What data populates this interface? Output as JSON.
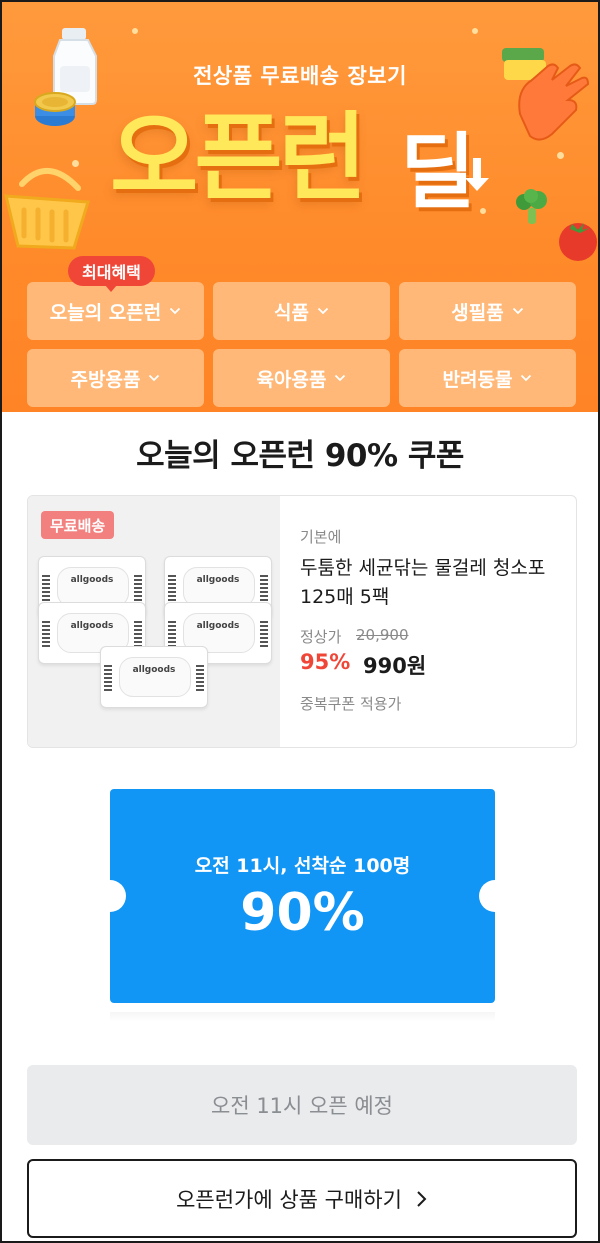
{
  "hero": {
    "subtitle": "전상품 무료배송 장보기",
    "title_main": "오픈런",
    "title_deal": "딜",
    "best_badge": "최대혜택"
  },
  "categories": [
    {
      "label": "오늘의 오픈런",
      "icon": "chevron-down-icon"
    },
    {
      "label": "식품",
      "icon": "chevron-down-icon"
    },
    {
      "label": "생필품",
      "icon": "chevron-down-icon"
    },
    {
      "label": "주방용품",
      "icon": "chevron-down-icon"
    },
    {
      "label": "육아용품",
      "icon": "chevron-down-icon"
    },
    {
      "label": "반려동물",
      "icon": "chevron-down-icon"
    }
  ],
  "section": {
    "title": "오늘의 오픈런 90% 쿠폰"
  },
  "product": {
    "free_shipping_badge": "무료배송",
    "pack_brand": "allgoods",
    "brand": "기본에",
    "name": "두툼한 세균닦는 물걸레 청소포 125매 5팩",
    "original_label": "정상가",
    "original_price": "20,900",
    "discount_rate": "95%",
    "sale_price": "990원",
    "note": "중복쿠폰 적용가"
  },
  "coupon": {
    "subtitle": "오전 11시, 선착순 100명",
    "rate": "90%"
  },
  "buttons": {
    "open_scheduled": "오전 11시 오픈 예정",
    "buy": "오픈런가에 상품 구매하기",
    "buy_icon": "chevron-right-icon"
  },
  "colors": {
    "hero_orange": "#ff8a2a",
    "title_yellow": "#ffe85a",
    "accent_red": "#f04638",
    "coupon_blue": "#1296f5"
  }
}
